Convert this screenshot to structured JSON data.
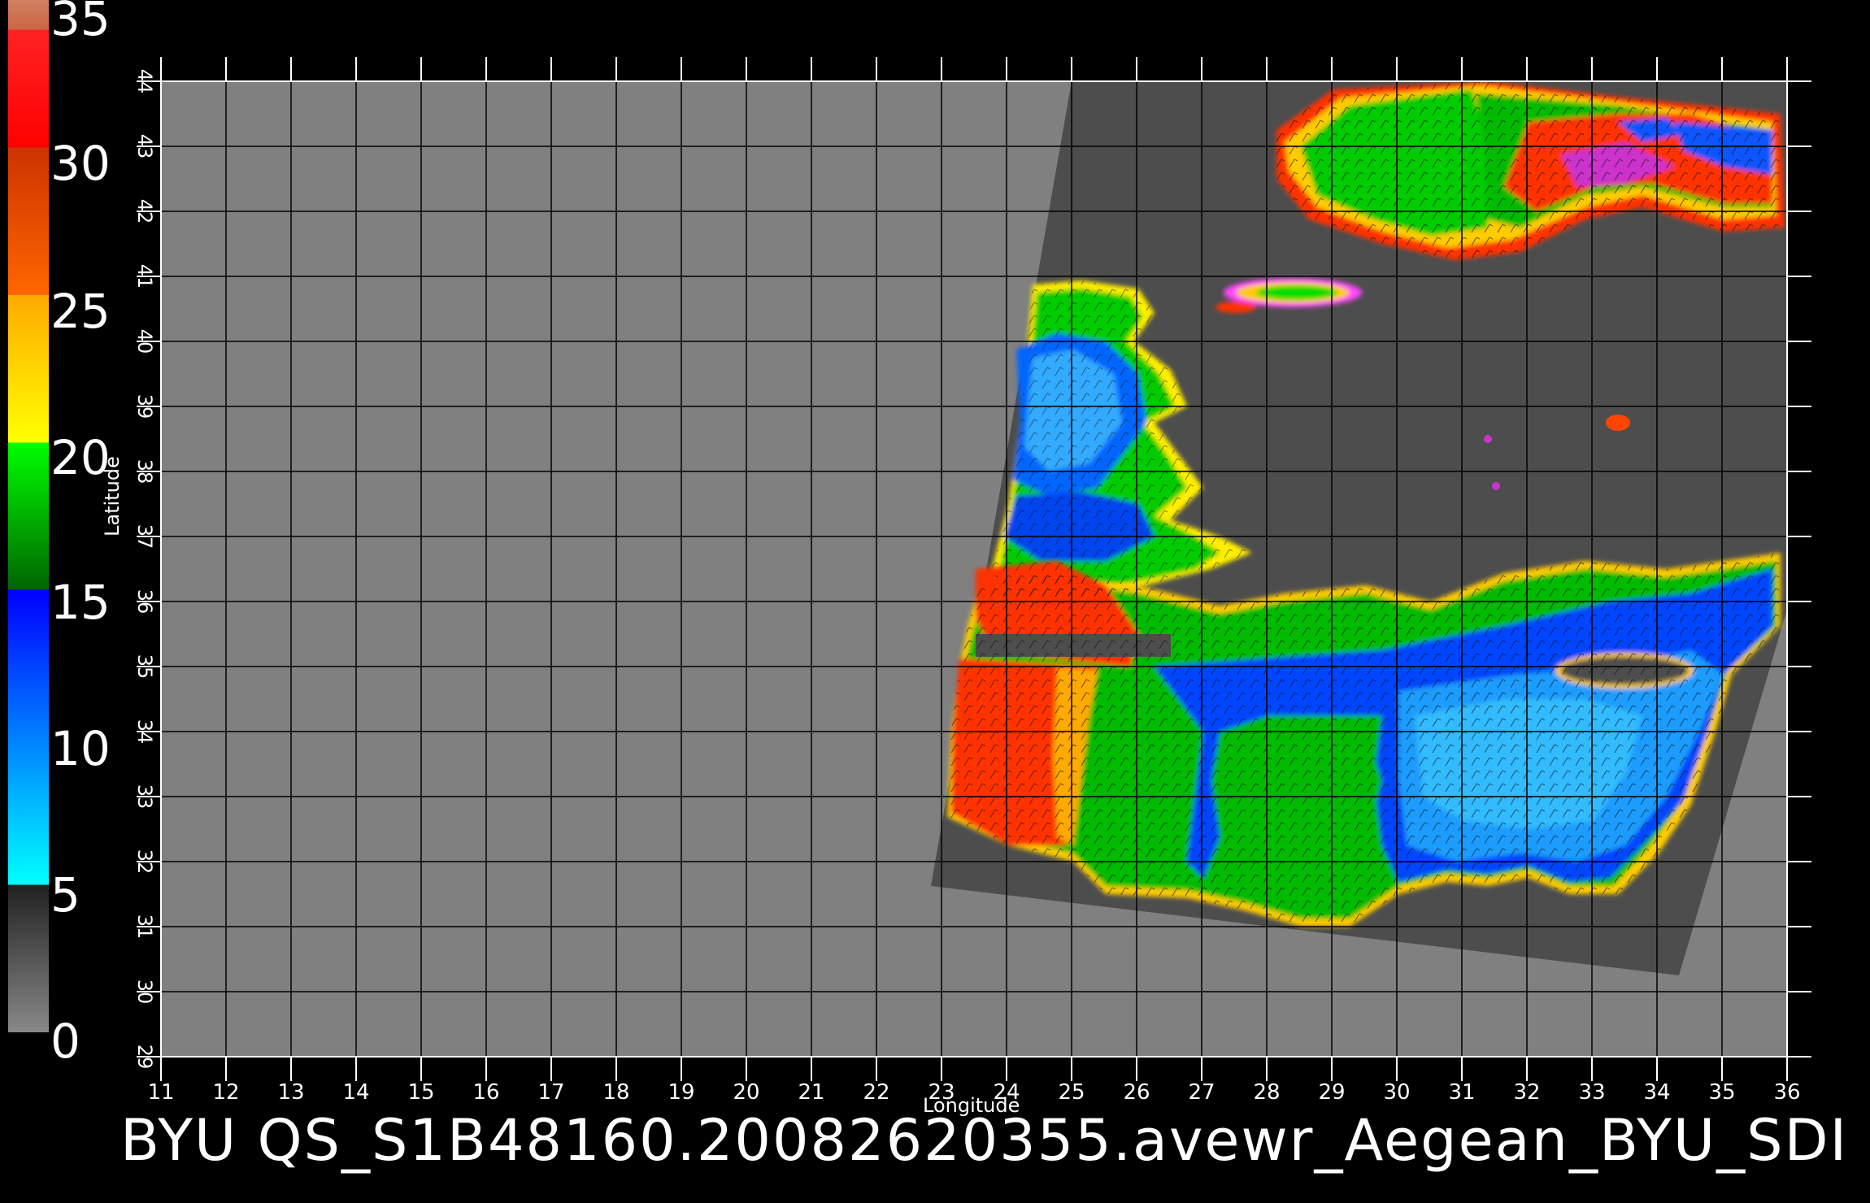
{
  "caption": "BYU  QS_S1B48160.20082620355.avewr_Aegean_BYU_SDI",
  "map": {
    "xlabel": "Longitude",
    "ylabel": "Latitude",
    "lon_ticks": [
      "11",
      "12",
      "13",
      "14",
      "15",
      "16",
      "17",
      "18",
      "19",
      "20",
      "21",
      "22",
      "23",
      "24",
      "25",
      "26",
      "27",
      "28",
      "29",
      "30",
      "31",
      "32",
      "33",
      "34",
      "35",
      "36"
    ],
    "lat_ticks": [
      "29",
      "30",
      "31",
      "32",
      "33",
      "34",
      "35",
      "36",
      "37",
      "38",
      "39",
      "40",
      "41",
      "42",
      "43",
      "44"
    ],
    "lon_range": [
      11,
      36
    ],
    "lat_range": [
      29,
      44
    ],
    "grid": true,
    "colors": {
      "background": "#000000",
      "land_nodata": "#808080",
      "swath_nodata": "#4d4d4d",
      "grid": "#000000"
    }
  },
  "colorbar": {
    "unit_range": [
      0,
      35
    ],
    "labels": [
      "35",
      "30",
      "25",
      "20",
      "15",
      "10",
      "5",
      "0"
    ],
    "stops": [
      {
        "value": 0,
        "color": "#888888"
      },
      {
        "value": 5,
        "color": "#222222"
      },
      {
        "value": 5,
        "color": "#00ffff"
      },
      {
        "value": 15,
        "color": "#0000ff"
      },
      {
        "value": 15,
        "color": "#006400"
      },
      {
        "value": 20,
        "color": "#00ff00"
      },
      {
        "value": 20,
        "color": "#ffff00"
      },
      {
        "value": 25,
        "color": "#ffaa00"
      },
      {
        "value": 25,
        "color": "#ff6600"
      },
      {
        "value": 30,
        "color": "#cc3300"
      },
      {
        "value": 30,
        "color": "#ff0000"
      },
      {
        "value": 34,
        "color": "#ff2222"
      },
      {
        "value": 34,
        "color": "#cc6644"
      },
      {
        "value": 35,
        "color": "#d08060"
      }
    ]
  }
}
